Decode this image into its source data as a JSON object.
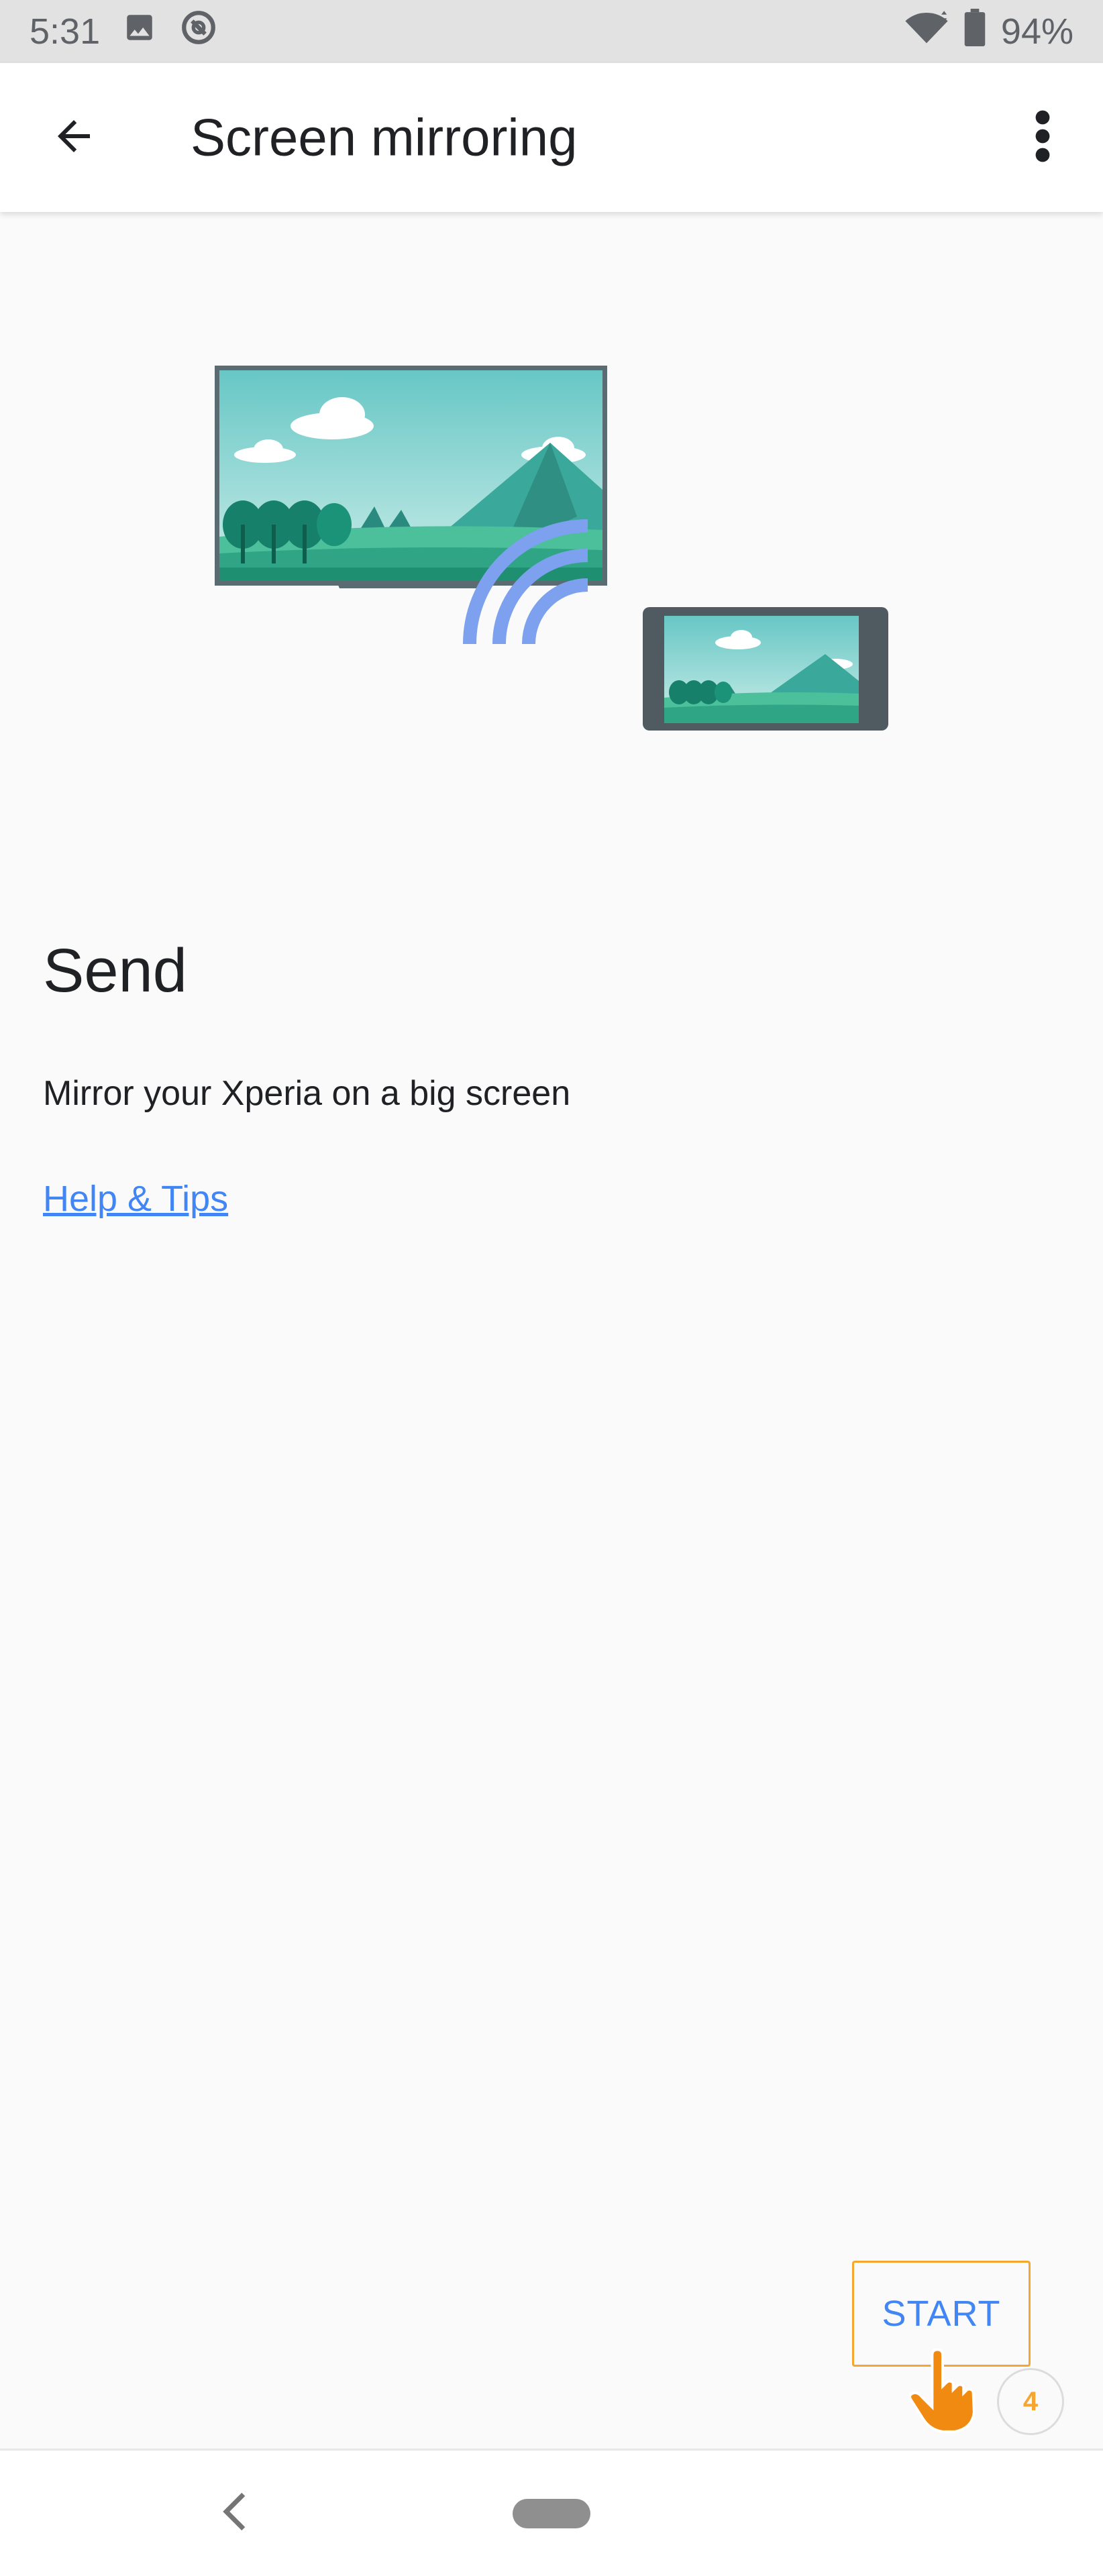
{
  "status_bar": {
    "time": "5:31",
    "battery_percent": "94%",
    "icons": [
      "image-icon",
      "data-saver-icon",
      "wifi-icon",
      "battery-icon"
    ]
  },
  "app_bar": {
    "title": "Screen mirroring",
    "back_icon": "arrow-back-icon",
    "overflow_icon": "more-vert-icon"
  },
  "content": {
    "heading": "Send",
    "description": "Mirror your Xperia on a big screen",
    "help_link": "Help & Tips"
  },
  "actions": {
    "start_label": "START",
    "step_number": "4"
  },
  "nav_bar": {
    "back_icon": "nav-back-icon",
    "home_icon": "nav-home-pill"
  },
  "colors": {
    "accent": "#4285f4",
    "highlight": "#f4a630",
    "app_bar_bg": "#ffffff",
    "status_bar_bg": "#e2e2e2",
    "background": "#fafafa"
  }
}
